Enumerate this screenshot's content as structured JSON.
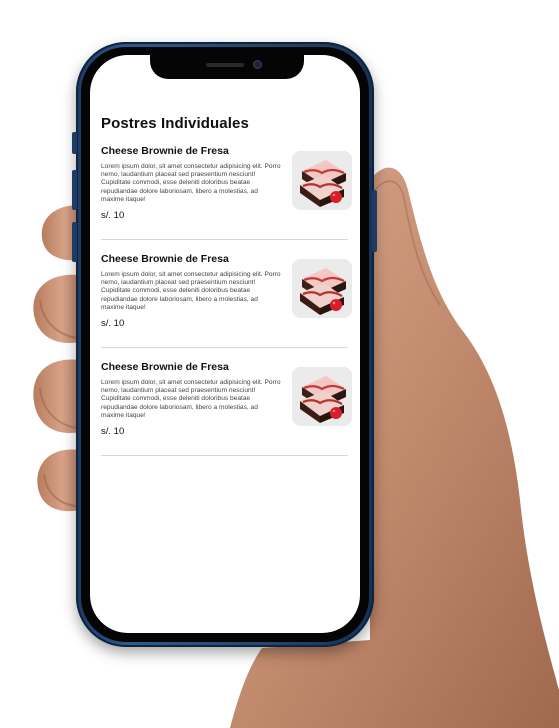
{
  "menu": {
    "section_title": "Postres Individuales",
    "items": [
      {
        "name": "Cheese Brownie de Fresa",
        "description": "Lorem ipsum dolor, sit amet consectetur adipisicing elit. Porro nemo, laudantium placeat sed praesentium nesciunt! Cupiditate commodi, esse deleniti doloribus beatae repudiandae dolore laboriosam, libero a molestias, ad maxime itaque!",
        "price": "s/. 10",
        "image_icon": "cheese-brownie-photo"
      },
      {
        "name": "Cheese Brownie de Fresa",
        "description": "Lorem ipsum dolor, sit amet consectetur adipisicing elit. Porro nemo, laudantium placeat sed praesentium nesciunt! Cupiditate commodi, esse deleniti doloribus beatae repudiandae dolore laboriosam, libero a molestias, ad maxime itaque!",
        "price": "s/. 10",
        "image_icon": "cheese-brownie-photo"
      },
      {
        "name": "Cheese Brownie de Fresa",
        "description": "Lorem ipsum dolor, sit amet consectetur adipisicing elit. Porro nemo, laudantium placeat sed praesentium nesciunt! Cupiditate commodi, esse deleniti doloribus beatae repudiandae dolore laboriosam, libero a molestias, ad maxime itaque!",
        "price": "s/. 10",
        "image_icon": "cheese-brownie-photo"
      }
    ]
  },
  "colors": {
    "phone_frame": "#2d5a8e",
    "skin": "#c9957a",
    "screen_bg": "#ffffff",
    "divider": "#d9d9d9"
  }
}
